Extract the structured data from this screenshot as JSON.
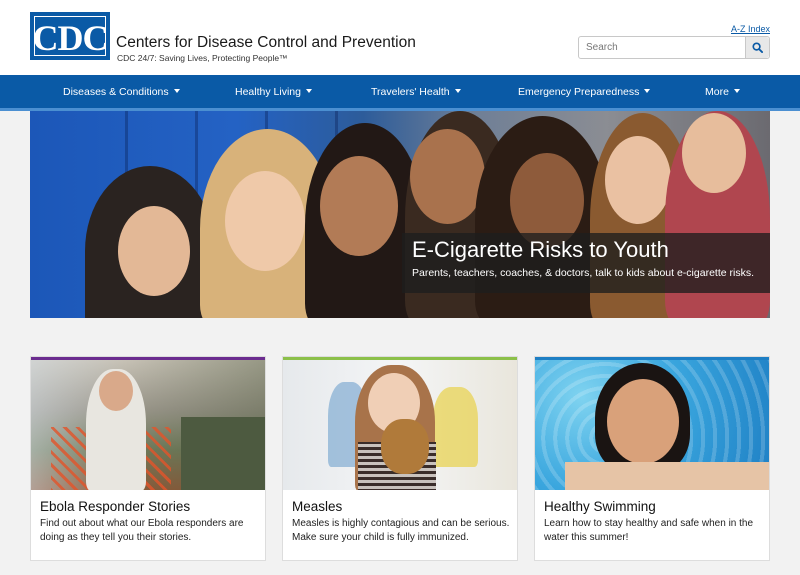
{
  "header": {
    "logo_text": "CDC",
    "org_name": "Centers for Disease Control and Prevention",
    "tagline": "CDC 24/7: Saving Lives, Protecting People™",
    "az_index": "A-Z Index",
    "search_placeholder": "Search",
    "search_icon": "magnifier-icon"
  },
  "nav": {
    "items": [
      {
        "label": "Diseases & Conditions"
      },
      {
        "label": "Healthy Living"
      },
      {
        "label": "Travelers' Health"
      },
      {
        "label": "Emergency Preparedness"
      },
      {
        "label": "More"
      }
    ]
  },
  "hero": {
    "title": "E-Cigarette Risks to Youth",
    "subtitle": "Parents, teachers, coaches, & doctors, talk to kids about e-cigarette risks."
  },
  "cards": [
    {
      "title": "Ebola Responder Stories",
      "text": "Find out about what our Ebola responders are doing as they tell you their stories.",
      "accent": "#6b2c8f"
    },
    {
      "title": "Measles",
      "text": "Measles is highly contagious and can be serious. Make sure your child is fully immunized.",
      "accent": "#8cc04a"
    },
    {
      "title": "Healthy Swimming",
      "text": "Learn how to stay healthy and safe when in the water this summer!",
      "accent": "#1e7fc4"
    }
  ],
  "colors": {
    "brand_blue": "#0a5aa6",
    "nav_underline": "#4b8fd1",
    "page_background": "#f2f2f2"
  }
}
